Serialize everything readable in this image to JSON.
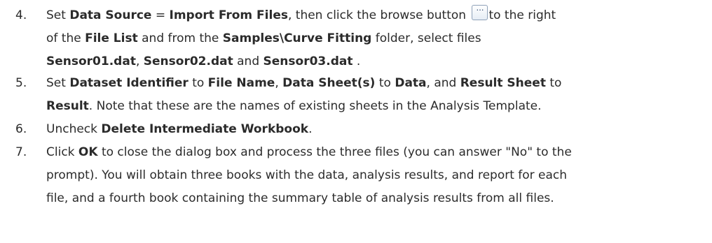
{
  "steps": [
    {
      "number": "4.",
      "lines": [
        {
          "a": "Set ",
          "b1": "Data Source",
          "c": " = ",
          "b2": "Import From Files",
          "d": ", then click the browse button ",
          "icon": "…",
          "e": "to the right"
        },
        {
          "a": "of the ",
          "b1": "File List",
          "c": " and from the ",
          "b2": "Samples\\Curve Fitting",
          "d": " folder, select files"
        },
        {
          "b1": "Sensor01.dat",
          "a": ", ",
          "b2": "Sensor02.dat",
          "c": " and ",
          "b3": "Sensor03.dat",
          "d": " ."
        }
      ]
    },
    {
      "number": "5.",
      "lines": [
        {
          "a": "Set ",
          "b1": "Dataset Identifier",
          "c": " to ",
          "b2": "File Name",
          "d": ", ",
          "b3": "Data Sheet(s)",
          "e": " to ",
          "b4": "Data",
          "f": ", and ",
          "b5": "Result Sheet",
          "g": " to"
        },
        {
          "b1": "Result",
          "a": ". Note that these are the names of existing sheets in the Analysis Template."
        }
      ]
    },
    {
      "number": "6.",
      "lines": [
        {
          "a": "Uncheck ",
          "b1": "Delete Intermediate Workbook",
          "c": "."
        }
      ]
    },
    {
      "number": "7.",
      "lines": [
        {
          "a": "Click ",
          "b1": "OK",
          "c": " to close the dialog box and process the three files (you can answer \"No\" to the"
        },
        {
          "a": "prompt). You will obtain three books with the data, analysis results, and report for each"
        },
        {
          "a": "file, and a fourth book containing the summary table of analysis results from all files."
        }
      ]
    }
  ]
}
